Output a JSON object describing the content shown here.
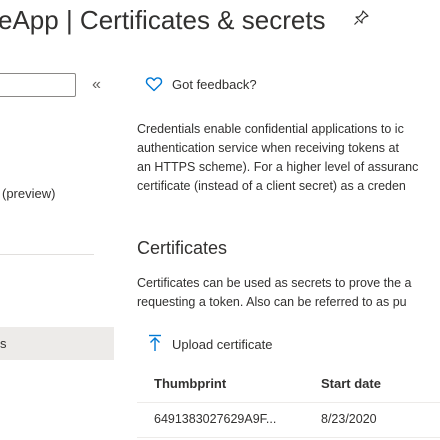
{
  "header": {
    "title": "eApp | Certificates & secrets"
  },
  "sidebar": {
    "search": {
      "value": "",
      "placeholder": ""
    },
    "collapse_glyph": "«",
    "items": [
      {
        "label": "(preview)"
      },
      {
        "label": "s",
        "selected": true
      }
    ]
  },
  "main": {
    "feedback": "Got feedback?",
    "intro_lines": [
      "Credentials enable confidential applications to ic",
      "authentication service when receiving tokens at",
      "an HTTPS scheme). For a higher level of assuranc",
      "certificate (instead of a client secret) as a creden"
    ],
    "certificates": {
      "title": "Certificates",
      "description_lines": [
        "Certificates can be used as secrets to prove the a",
        "requesting a token. Also can be referred to as pu"
      ],
      "upload_label": "Upload certificate",
      "columns": [
        "Thumbprint",
        "Start date"
      ],
      "rows": [
        {
          "thumbprint": "6491383027629A9F...",
          "start_date": "8/23/2020"
        }
      ]
    }
  },
  "colors": {
    "accent": "#0078d4",
    "text": "#323130",
    "selected_bg": "#edebe9",
    "divider": "#e1dfdd"
  },
  "icons": {
    "pin": "pin-icon",
    "feedback": "heart-icon",
    "upload": "upload-icon"
  }
}
